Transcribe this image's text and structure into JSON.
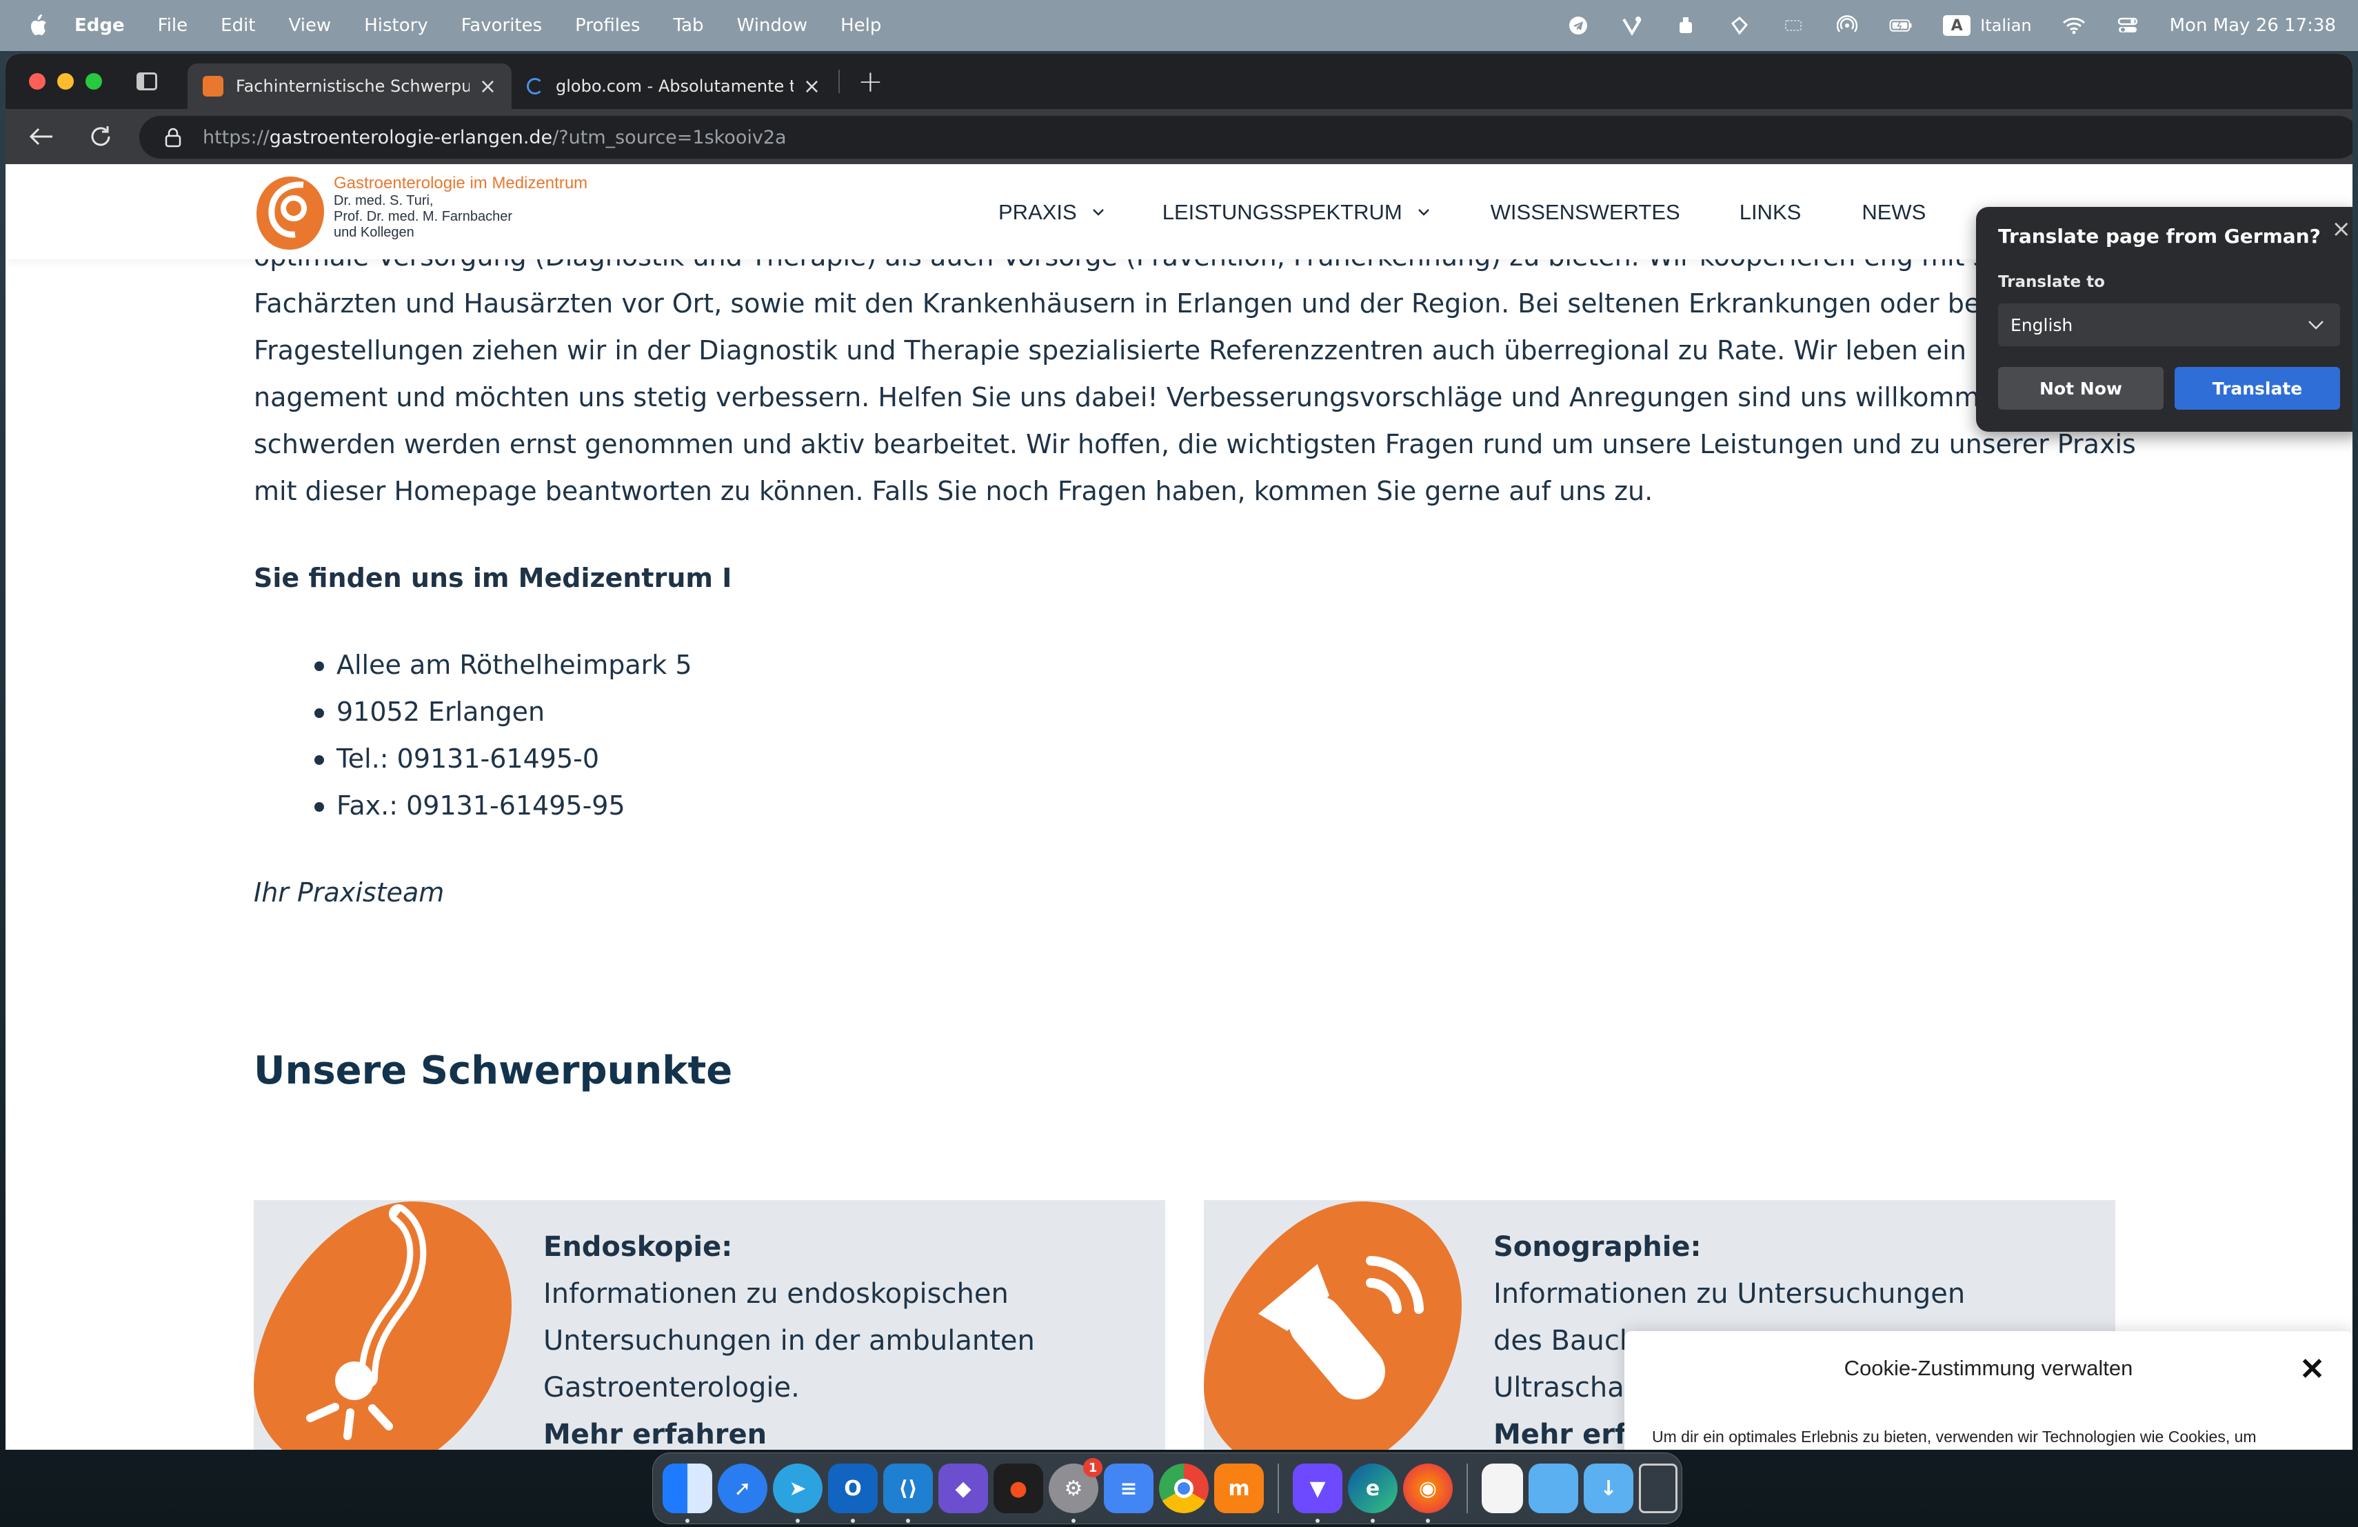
{
  "menubar": {
    "app_name": "Edge",
    "items": [
      "File",
      "Edit",
      "View",
      "History",
      "Favorites",
      "Profiles",
      "Tab",
      "Window",
      "Help"
    ],
    "input_language_badge": "A",
    "input_language": "Italian",
    "clock": "Mon May 26  17:38"
  },
  "tabs": [
    {
      "title": "Fachinternistische Schwerpunkte",
      "active": true
    },
    {
      "title": "globo.com - Absolutamente tudo",
      "active": false
    }
  ],
  "address": {
    "scheme": "https://",
    "host": "gastroenterologie-erlangen.de",
    "path": "/?utm_source=1skooiv2a"
  },
  "site": {
    "logo": {
      "title": "Gastroenterologie im Medizentrum",
      "line1": "Dr. med. S. Turi,",
      "line2": "Prof. Dr. med. M. Farnbacher",
      "line3": "und Kollegen"
    },
    "nav": [
      {
        "label": "PRAXIS",
        "dropdown": true
      },
      {
        "label": "LEISTUNGSSPEKTRUM",
        "dropdown": true
      },
      {
        "label": "WISSENSWERTES",
        "dropdown": false
      },
      {
        "label": "LINKS",
        "dropdown": false
      },
      {
        "label": "NEWS",
        "dropdown": false
      }
    ]
  },
  "content": {
    "para_lines": [
      "optimale Versorgung (Diagnostik und Therapie) als auch Vorsorge (Prävention, Früherkennung) zu bieten. Wir kooperieren eng mit spe",
      "Fachärzten und Hausärzten vor Ort, sowie mit den Krankenhäusern in Erlangen und der Region. Bei seltenen Erkrankungen oder beso",
      "Fragestellungen ziehen wir in der Diagnostik und Therapie spezialisierte Referenzzentren auch überregional zu Rate. Wir leben ein Qua",
      "nagement und möchten uns stetig verbessern. Helfen Sie uns dabei! Verbesserungsvorschläge und  Anregungen sind uns willkommen. Be-",
      "schwerden werden ernst genommen und aktiv bearbeitet. Wir hoffen, die wichtigsten Fragen rund um unsere Leistungen und zu unserer Praxis",
      "mit dieser Homepage beantworten zu können. Falls Sie noch Fragen haben, kommen Sie gerne auf uns zu."
    ],
    "find_title": "Sie finden uns im Medizentrum I",
    "address_list": [
      "Allee am Röthelheimpark 5",
      "91052 Erlangen",
      "Tel.: 09131-61495-0",
      "Fax.: 09131-61495-95"
    ],
    "signature": "Ihr Praxisteam",
    "section_title": "Unsere Schwerpunkte"
  },
  "cards": [
    {
      "title": "Endoskopie:",
      "lines": [
        "Informationen zu endoskopischen",
        "Untersuchungen in der ambulanten",
        "Gastroenterologie."
      ],
      "more": "Mehr erfahren"
    },
    {
      "title": "Sonographie:",
      "lines": [
        "Informationen zu Untersuchungen",
        "des Bauch",
        "Ultraschall"
      ],
      "more": "Mehr erfa"
    }
  ],
  "translate_popup": {
    "title": "Translate page from German?",
    "label": "Translate to",
    "selected_language": "English",
    "not_now": "Not Now",
    "translate": "Translate"
  },
  "cookie_popup": {
    "title": "Cookie-Zustimmung verwalten",
    "close": "✕",
    "text": "Um dir ein optimales Erlebnis zu bieten, verwenden wir Technologien wie Cookies, um Geräteinformationen zu speichern und/oder darauf zuzugreifen. Wenn du diesen Technologien zustimmst, können wir Daten wie das Surfverhalten oder eindeutige IDs"
  },
  "dock": {
    "settings_badge": "1"
  },
  "colors": {
    "brand_orange": "#e9782e",
    "text_navy": "#1e3347",
    "card_bg": "#e4e8ec",
    "translate_blue": "#2f6ed6"
  }
}
